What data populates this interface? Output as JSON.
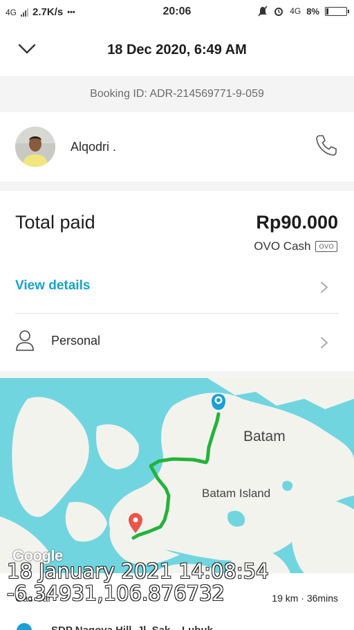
{
  "status_bar": {
    "network_left": "4G",
    "speed": "2.7K/s",
    "dots": "•••",
    "time": "20:06",
    "network_right": "4G",
    "battery": "8%"
  },
  "header": {
    "title": "18 Dec 2020, 6:49 AM"
  },
  "booking": {
    "id_text": "Booking ID: ADR-214569771-9-059"
  },
  "driver": {
    "name": "Alqodri ."
  },
  "payment": {
    "total_label": "Total paid",
    "total_amount": "Rp90.000",
    "method": "OVO Cash",
    "method_badge": "OVO",
    "view_details": "View details",
    "category": "Personal"
  },
  "map": {
    "city_label": "Batam",
    "island_label": "Batam Island",
    "google_logo": "Google",
    "origin_label": "Gas Car",
    "distance_time": "19 km · 36mins",
    "address_preview": "SDP Nagoya Hill, Jl. Sak... Lubuk..."
  },
  "watermark": {
    "line1": "18 January 2021 14:08:54",
    "line2": "-6.34931,106.876732"
  },
  "colors": {
    "accent": "#15a3c9",
    "route": "#22b43a",
    "water": "#71d5e0",
    "land": "#f3f3ee",
    "pickup_pin": "#1a9fd6",
    "dropoff_pin": "#e8574a"
  }
}
